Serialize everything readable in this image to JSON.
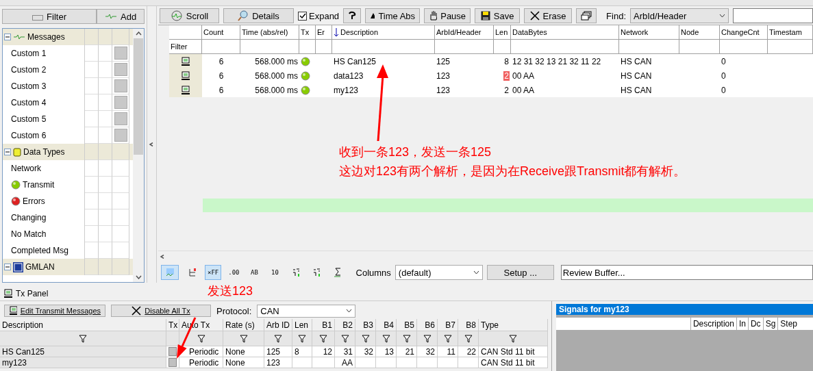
{
  "left_panel": {
    "buttons": [
      {
        "label": "Filter",
        "kind": "filter"
      },
      {
        "label": "Add",
        "kind": "add"
      }
    ],
    "tree": [
      {
        "label": "Messages",
        "kind": "messages",
        "expanded": true,
        "children": [
          {
            "label": "Custom 1",
            "kind": "custom"
          },
          {
            "label": "Custom 2",
            "kind": "custom"
          },
          {
            "label": "Custom 3",
            "kind": "custom"
          },
          {
            "label": "Custom 4",
            "kind": "custom"
          },
          {
            "label": "Custom 5",
            "kind": "custom"
          },
          {
            "label": "Custom 6",
            "kind": "custom"
          }
        ]
      },
      {
        "label": "Data Types",
        "kind": "datatypes",
        "expanded": true,
        "children": [
          {
            "label": "Network",
            "kind": "plain"
          },
          {
            "label": "Transmit",
            "kind": "transmit"
          },
          {
            "label": "Errors",
            "kind": "error"
          },
          {
            "label": "Changing",
            "kind": "plain"
          },
          {
            "label": "No Match",
            "kind": "plain"
          },
          {
            "label": "Completed Msg",
            "kind": "plain"
          }
        ]
      },
      {
        "label": "GMLAN",
        "kind": "gmlan",
        "expanded": true
      }
    ]
  },
  "toolbar": {
    "items": [
      {
        "kind": "button",
        "label": "Scroll"
      },
      {
        "kind": "button",
        "label": "Details"
      },
      {
        "kind": "checkbox",
        "label": "Expand",
        "checked": true
      },
      {
        "kind": "iconbutton"
      },
      {
        "kind": "button",
        "label": "Time Abs"
      },
      {
        "kind": "button",
        "label": "Pause"
      },
      {
        "kind": "button",
        "label": "Save"
      },
      {
        "kind": "button",
        "label": "Erase"
      },
      {
        "kind": "iconbutton"
      }
    ],
    "find_label": "Find:",
    "find_select": "ArbId/Header"
  },
  "messages": {
    "columns": [
      "Count",
      "Time (abs/rel)",
      "Tx",
      "Er",
      "Description",
      "ArbId/Header",
      "Len",
      "DataBytes",
      "Network",
      "Node",
      "ChangeCnt",
      "Timestam"
    ],
    "filter_label": "Filter",
    "rows": [
      {
        "count": "6",
        "time": "568.000 ms",
        "description": "HS Can125",
        "arbid": "125",
        "len": "8",
        "len_changed": false,
        "data": "12 31 32 13 21 32 11 22",
        "network": "HS CAN",
        "changecnt": "0"
      },
      {
        "count": "6",
        "time": "568.000 ms",
        "description": "data123",
        "arbid": "123",
        "len": "2",
        "len_changed": true,
        "data": "00 AA",
        "network": "HS CAN",
        "changecnt": "0"
      },
      {
        "count": "6",
        "time": "568.000 ms",
        "description": "my123",
        "arbid": "123",
        "len": "2",
        "len_changed": false,
        "data": "00 AA",
        "network": "HS CAN",
        "changecnt": "0"
      }
    ]
  },
  "bottom_toolbar": {
    "formats": [
      {
        "label": "×FF",
        "selected": true
      },
      {
        "label": ".00",
        "selected": false
      },
      {
        "label": "AB",
        "selected": false
      },
      {
        "label": "10",
        "selected": false
      }
    ],
    "columns_label": "Columns",
    "columns_select": "(default)",
    "setup_button": "Setup ...",
    "review_field": "Review Buffer..."
  },
  "annotations": [
    {
      "text": "收到一条123，发送一条125"
    },
    {
      "text": "这边对123有两个解析，是因为在Receive跟Transmit都有解析。"
    },
    {
      "text": "发送123"
    }
  ],
  "tx_panel": {
    "title": "Tx Panel",
    "buttons": [
      "Edit Transmit Messages",
      "Disable All Tx"
    ],
    "protocol_label": "Protocol:",
    "protocol": "CAN",
    "columns": [
      "Description",
      "Tx",
      "Auto Tx",
      "Rate (s)",
      "Arb ID",
      "Len",
      "B1",
      "B2",
      "B3",
      "B4",
      "B5",
      "B6",
      "B7",
      "B8",
      "Type"
    ],
    "rows": [
      {
        "cells": [
          "HS Can125",
          "",
          "Periodic",
          "None",
          "125",
          "8",
          "12",
          "31",
          "32",
          "13",
          "21",
          "32",
          "11",
          "22",
          "CAN Std 11 bit"
        ]
      },
      {
        "cells": [
          "my123",
          "",
          "Periodic",
          "None",
          "123",
          "",
          "",
          "AA",
          "",
          "",
          "",
          "",
          "",
          "",
          "CAN Std 11 bit"
        ]
      }
    ]
  },
  "signals_panel": {
    "title": "Signals for my123",
    "columns": [
      "Description",
      "In",
      "Dc",
      "Sg",
      "Step"
    ]
  }
}
